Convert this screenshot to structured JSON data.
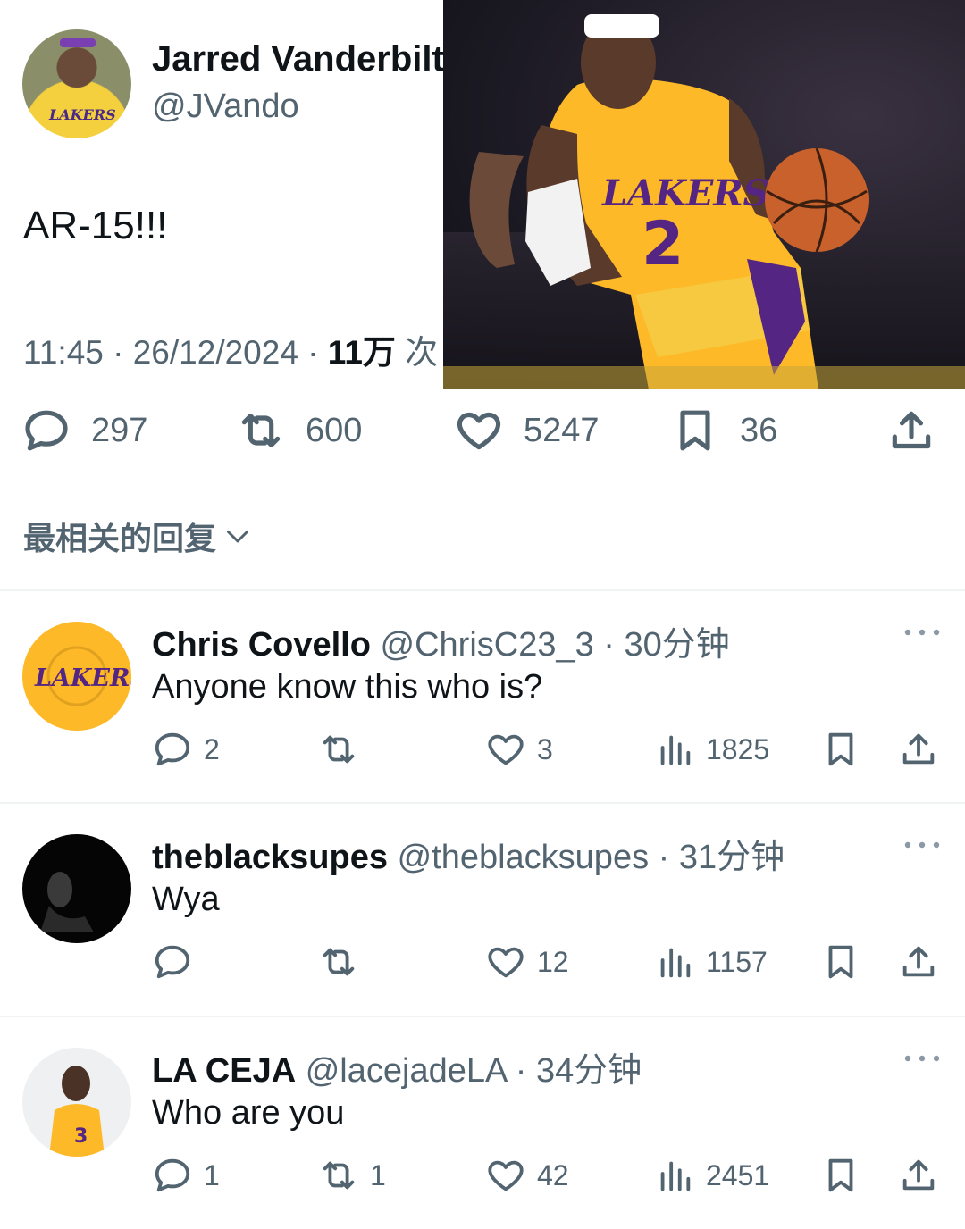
{
  "tweet": {
    "author_name": "Jarred Vanderbilt",
    "author_handle": "@JVando",
    "text": "AR-15!!!",
    "time_date": "11:45 · 26/12/2024 · ",
    "views": "11万",
    "views_suffix": " 次",
    "counts": {
      "replies": "297",
      "retweets": "600",
      "likes": "5247",
      "bookmarks": "36"
    },
    "photo_jersey": "LAKERS",
    "photo_number": "2"
  },
  "replies_sort_label": "最相关的回复",
  "replies": [
    {
      "name": "Chris Covello",
      "handle_time": "@ChrisC23_3 · 30分钟",
      "text": "Anyone know this who is?",
      "avatar_text": "LAKERS",
      "counts": {
        "replies": "2",
        "retweets": "",
        "likes": "3",
        "views": "1825"
      }
    },
    {
      "name": "theblacksupes",
      "handle_time": "@theblacksupes · 31分钟",
      "text": "Wya",
      "counts": {
        "replies": "",
        "retweets": "",
        "likes": "12",
        "views": "1157"
      }
    },
    {
      "name": "LA CEJA",
      "handle_time": "@lacejadeLA · 34分钟",
      "text": "Who are you",
      "counts": {
        "replies": "1",
        "retweets": "1",
        "likes": "42",
        "views": "2451"
      }
    }
  ],
  "colors": {
    "text_primary": "#0f1419",
    "text_secondary": "#536471",
    "divider": "#eff3f4",
    "lakers_gold": "#fdb927",
    "lakers_purple": "#552583"
  },
  "icons": [
    "reply-icon",
    "retweet-icon",
    "like-icon",
    "bookmark-icon",
    "share-icon",
    "views-icon",
    "more-icon",
    "chevron-down-icon"
  ]
}
